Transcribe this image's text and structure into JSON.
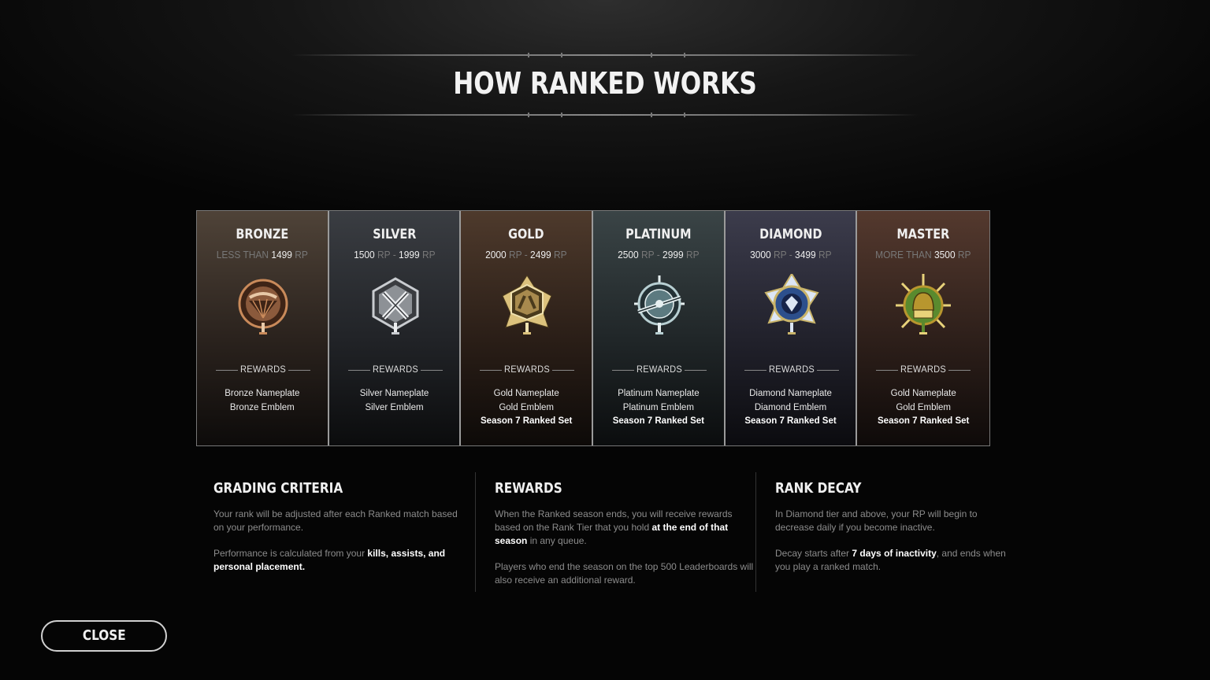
{
  "page": {
    "title": "HOW RANKED WORKS"
  },
  "tiers": [
    {
      "id": "bronze",
      "name": "BRONZE",
      "range": [
        {
          "text": "LESS THAN ",
          "dim": true
        },
        {
          "text": "1499",
          "dim": false
        },
        {
          "text": " RP",
          "dim": true
        }
      ],
      "rewards_label": "REWARDS",
      "rewards": [
        {
          "text": "Bronze Nameplate",
          "bold": false
        },
        {
          "text": "Bronze Emblem",
          "bold": false
        }
      ],
      "colors": {
        "main": "#8b5a3c",
        "accent": "#c98a5a",
        "dark": "#3e2416",
        "light": "#e8c9a8"
      }
    },
    {
      "id": "silver",
      "name": "SILVER",
      "range": [
        {
          "text": "1500",
          "dim": false
        },
        {
          "text": " RP - ",
          "dim": true
        },
        {
          "text": "1999",
          "dim": false
        },
        {
          "text": " RP",
          "dim": true
        }
      ],
      "rewards_label": "REWARDS",
      "rewards": [
        {
          "text": "Silver Nameplate",
          "bold": false
        },
        {
          "text": "Silver Emblem",
          "bold": false
        }
      ],
      "colors": {
        "main": "#8d9196",
        "accent": "#c9ccd0",
        "dark": "#3a3c40",
        "light": "#eceef0"
      }
    },
    {
      "id": "gold",
      "name": "GOLD",
      "range": [
        {
          "text": "2000",
          "dim": false
        },
        {
          "text": " RP - ",
          "dim": true
        },
        {
          "text": "2499",
          "dim": false
        },
        {
          "text": " RP",
          "dim": true
        }
      ],
      "rewards_label": "REWARDS",
      "rewards": [
        {
          "text": "Gold Nameplate",
          "bold": false
        },
        {
          "text": "Gold Emblem",
          "bold": false
        },
        {
          "text": "Season 7 Ranked Set",
          "bold": true
        }
      ],
      "colors": {
        "main": "#a88a4e",
        "accent": "#dcc27d",
        "dark": "#4a3a1c",
        "light": "#f0e2b0"
      }
    },
    {
      "id": "platinum",
      "name": "PLATINUM",
      "range": [
        {
          "text": "2500",
          "dim": false
        },
        {
          "text": " RP - ",
          "dim": true
        },
        {
          "text": "2999",
          "dim": false
        },
        {
          "text": " RP",
          "dim": true
        }
      ],
      "rewards_label": "REWARDS",
      "rewards": [
        {
          "text": "Platinum Nameplate",
          "bold": false
        },
        {
          "text": "Platinum Emblem",
          "bold": false
        },
        {
          "text": "Season 7 Ranked Set",
          "bold": true
        }
      ],
      "colors": {
        "main": "#5c7a80",
        "accent": "#b7cfd2",
        "dark": "#243236",
        "light": "#e6f0f1"
      }
    },
    {
      "id": "diamond",
      "name": "DIAMOND",
      "range": [
        {
          "text": "3000",
          "dim": false
        },
        {
          "text": " RP - ",
          "dim": true
        },
        {
          "text": "3499",
          "dim": false
        },
        {
          "text": " RP",
          "dim": true
        }
      ],
      "rewards_label": "REWARDS",
      "rewards": [
        {
          "text": "Diamond Nameplate",
          "bold": false
        },
        {
          "text": "Diamond Emblem",
          "bold": false
        },
        {
          "text": "Season 7 Ranked Set",
          "bold": true
        }
      ],
      "colors": {
        "main": "#2c4f8c",
        "accent": "#c9b46a",
        "dark": "#16244a",
        "light": "#dce6f5"
      }
    },
    {
      "id": "master",
      "name": "MASTER",
      "range": [
        {
          "text": "MORE THAN ",
          "dim": true
        },
        {
          "text": "3500",
          "dim": false
        },
        {
          "text": " RP",
          "dim": true
        }
      ],
      "rewards_label": "REWARDS",
      "rewards": [
        {
          "text": "Gold Nameplate",
          "bold": false
        },
        {
          "text": "Gold Emblem",
          "bold": false
        },
        {
          "text": "Season 7 Ranked Set",
          "bold": true
        }
      ],
      "colors": {
        "main": "#b8962e",
        "accent": "#e8d27a",
        "dark": "#4a3a10",
        "light": "#5a8a2e"
      }
    }
  ],
  "info_sections": [
    {
      "id": "grading-criteria",
      "title": "GRADING CRITERIA",
      "paragraphs": [
        [
          {
            "text": "Your rank will be adjusted after each Ranked match based on your performance.",
            "bold": false
          }
        ],
        [
          {
            "text": "Performance is calculated from your ",
            "bold": false
          },
          {
            "text": "kills, assists, and personal placement.",
            "bold": true
          }
        ]
      ]
    },
    {
      "id": "rewards",
      "title": "REWARDS",
      "paragraphs": [
        [
          {
            "text": "When the Ranked season ends, you will receive rewards based on the Rank Tier that you hold ",
            "bold": false
          },
          {
            "text": "at the end of that season",
            "bold": true
          },
          {
            "text": " in any queue.",
            "bold": false
          }
        ],
        [
          {
            "text": "Players who end the season on the top 500 Leaderboards will also receive an additional reward.",
            "bold": false
          }
        ]
      ]
    },
    {
      "id": "rank-decay",
      "title": "RANK DECAY",
      "paragraphs": [
        [
          {
            "text": "In Diamond tier and above, your RP will begin to decrease daily if you become inactive.",
            "bold": false
          }
        ],
        [
          {
            "text": "Decay starts after ",
            "bold": false
          },
          {
            "text": "7 days of inactivity",
            "bold": true
          },
          {
            "text": ", and ends when you play a ranked match.",
            "bold": false
          }
        ]
      ]
    }
  ],
  "close_button": {
    "label": "CLOSE"
  }
}
